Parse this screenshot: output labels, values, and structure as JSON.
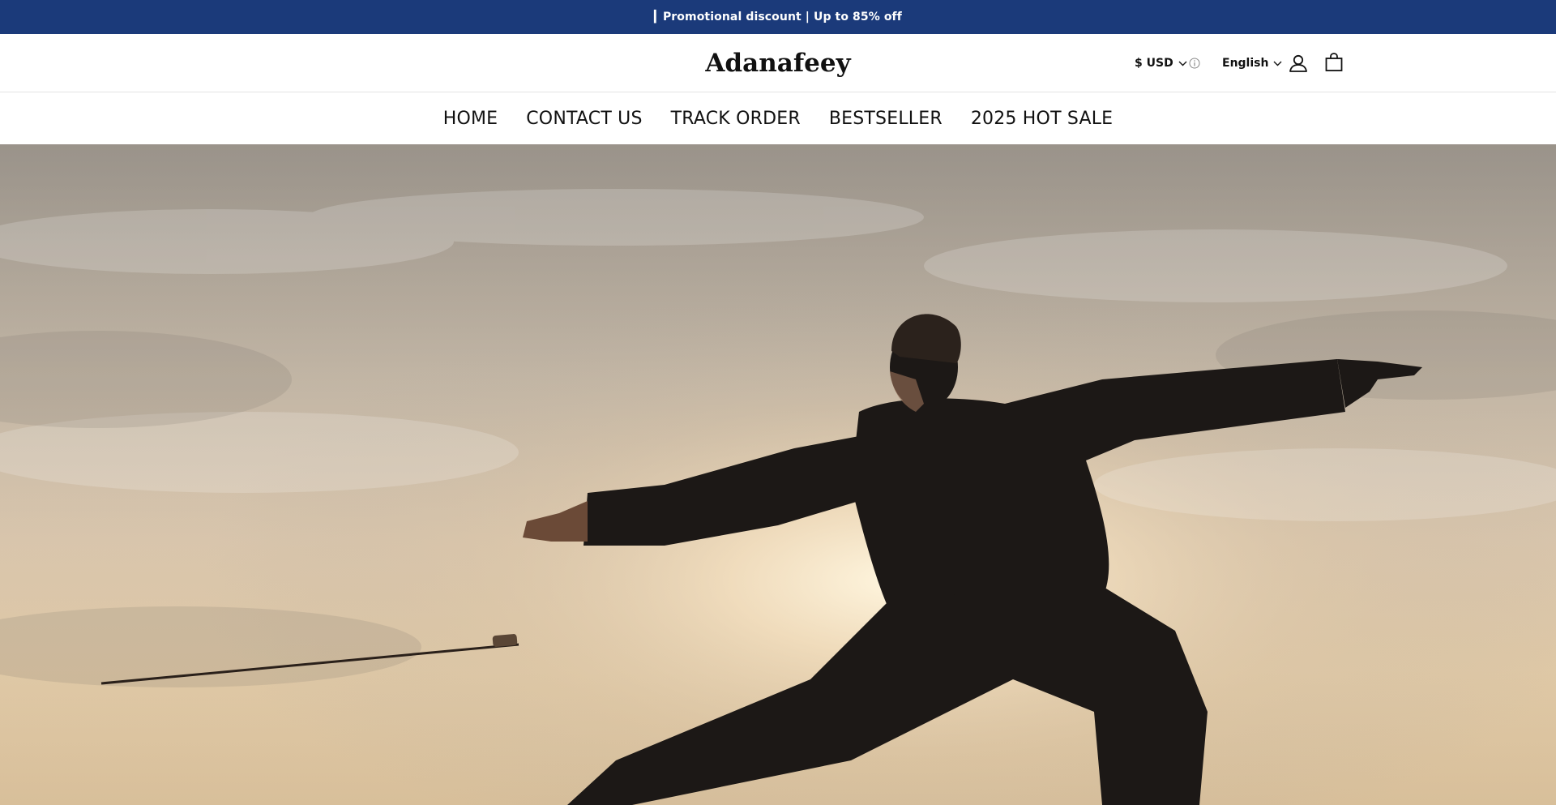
{
  "announcement": {
    "text": "▎Promotional discount | Up to 85% off"
  },
  "header": {
    "logo": "Adanafeey",
    "currency": "$ USD",
    "language": "English",
    "icons": {
      "currency_chevron": "chevron-down-icon",
      "info": "info-icon",
      "language_chevron": "chevron-down-icon",
      "account": "user-icon",
      "cart": "shopping-bag-icon"
    }
  },
  "nav": {
    "items": [
      {
        "label": "HOME"
      },
      {
        "label": "CONTACT US"
      },
      {
        "label": "TRACK ORDER"
      },
      {
        "label": "BESTSELLER"
      },
      {
        "label": "2025 HOT SALE"
      }
    ]
  },
  "colors": {
    "announcement_bg": "#1b3a7a",
    "announcement_text": "#ffffff",
    "text": "#111111",
    "background": "#ffffff"
  }
}
